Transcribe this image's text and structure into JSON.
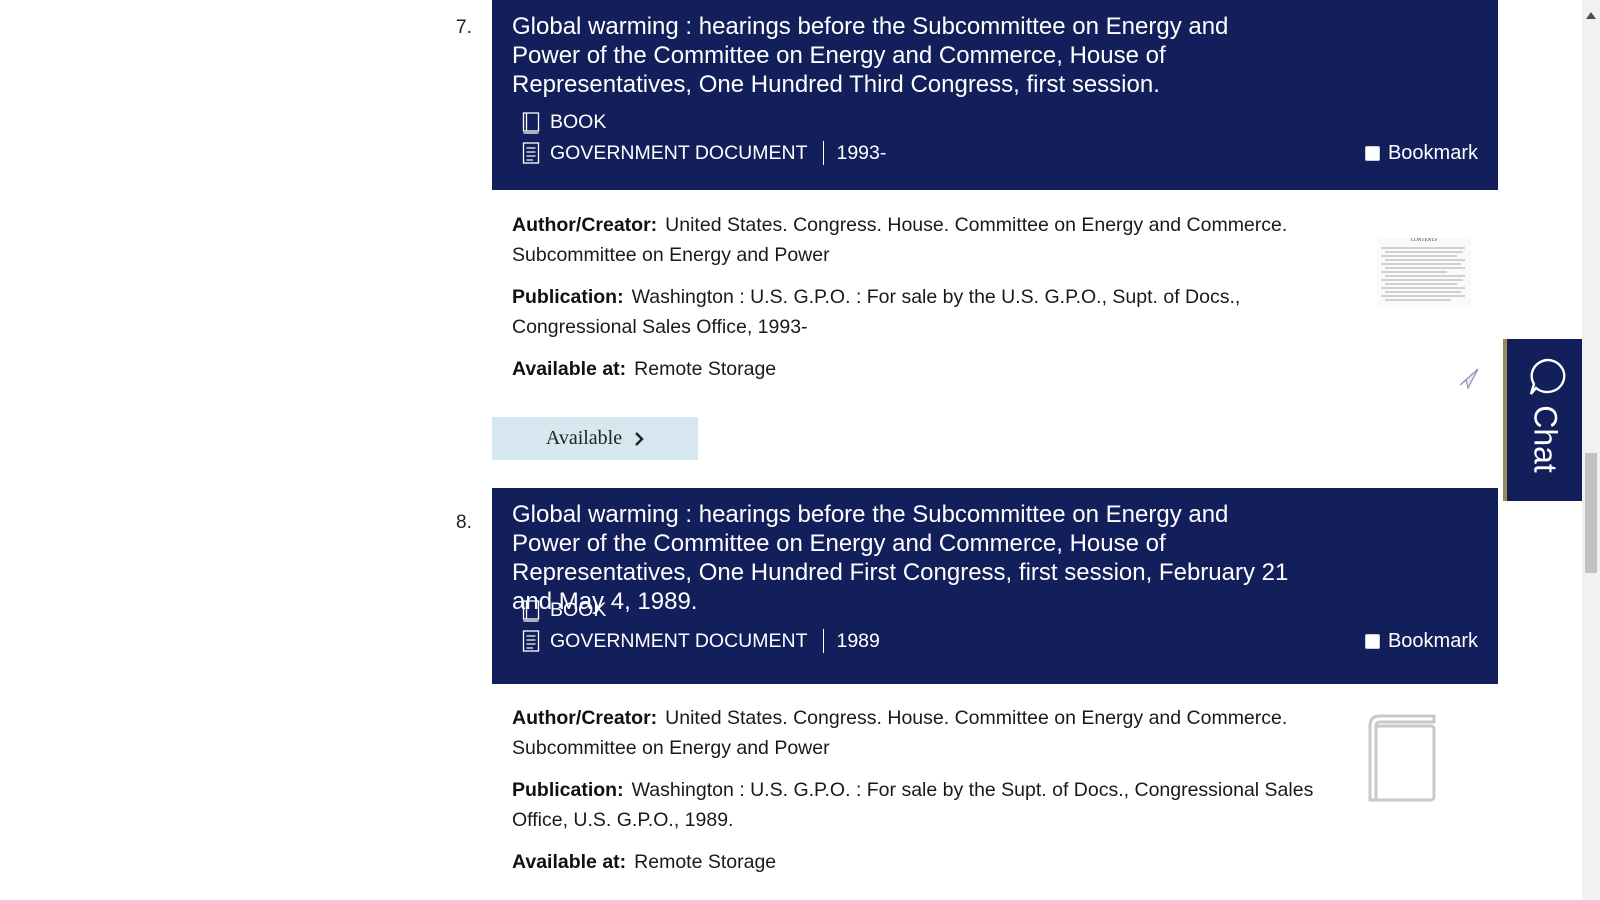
{
  "results": [
    {
      "number": "7.",
      "title": "Global warming : hearings before the Subcommittee on Energy and Power of the Committee on Energy and Commerce, House of Representatives, One Hundred Third Congress, first session.",
      "format_book": "BOOK",
      "format_doc": "GOVERNMENT DOCUMENT",
      "date": "1993-",
      "bookmark_label": "Bookmark",
      "author_label": "Author/Creator:",
      "author": "United States. Congress. House. Committee on Energy and Commerce. Subcommittee on Energy and Power",
      "publication_label": "Publication:",
      "publication": "Washington : U.S. G.P.O. : For sale by the U.S. G.P.O., Supt. of Docs., Congressional Sales Office, 1993-",
      "available_label": "Available at:",
      "available_at": "Remote Storage",
      "status_button": "Available",
      "thumbnail_heading": "CONTENTS"
    },
    {
      "number": "8.",
      "title": "Global warming : hearings before the Subcommittee on Energy and Power of the Committee on Energy and Commerce, House of Representatives, One Hundred First Congress, first session, February 21 and May 4, 1989.",
      "format_book": "BOOK",
      "format_doc": "GOVERNMENT DOCUMENT",
      "date": "1989",
      "bookmark_label": "Bookmark",
      "author_label": "Author/Creator:",
      "author": "United States. Congress. House. Committee on Energy and Commerce. Subcommittee on Energy and Power",
      "publication_label": "Publication:",
      "publication": "Washington : U.S. G.P.O. : For sale by the Supt. of Docs., Congressional Sales Office, U.S. G.P.O., 1989.",
      "available_label": "Available at:",
      "available_at": "Remote Storage"
    }
  ],
  "chat": {
    "label": "Chat"
  },
  "colors": {
    "header_bg": "#121f5b",
    "button_bg": "#d7e7f0"
  }
}
